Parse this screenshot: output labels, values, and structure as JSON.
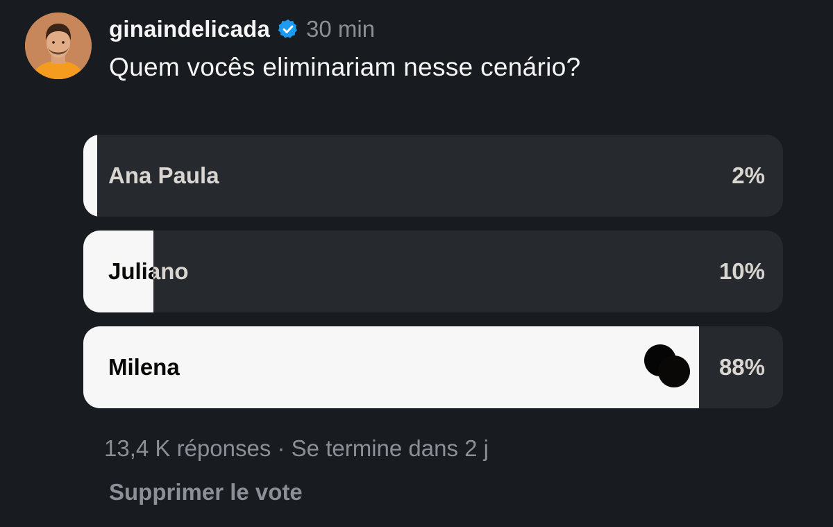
{
  "post": {
    "username": "ginaindelicada",
    "verified_icon": "verified-badge-icon",
    "time": "30 min",
    "question": "Quem vocês eliminariam nesse cenário?"
  },
  "poll": {
    "options": [
      {
        "label": "Ana Paula",
        "percent_text": "2%",
        "percent": 2
      },
      {
        "label": "Juliano",
        "percent_text": "10%",
        "percent": 10
      },
      {
        "label": "Milena",
        "percent_text": "88%",
        "percent": 88
      }
    ],
    "responses_text": "13,4 K réponses · Se termine dans 2 j",
    "remove_vote_label": "Supprimer le vote"
  },
  "colors": {
    "background": "#181b1f",
    "option_bg": "#26292e",
    "fill": "#f7f7f8",
    "muted_text": "#8b9097",
    "verified_blue": "#1d9bf0"
  }
}
